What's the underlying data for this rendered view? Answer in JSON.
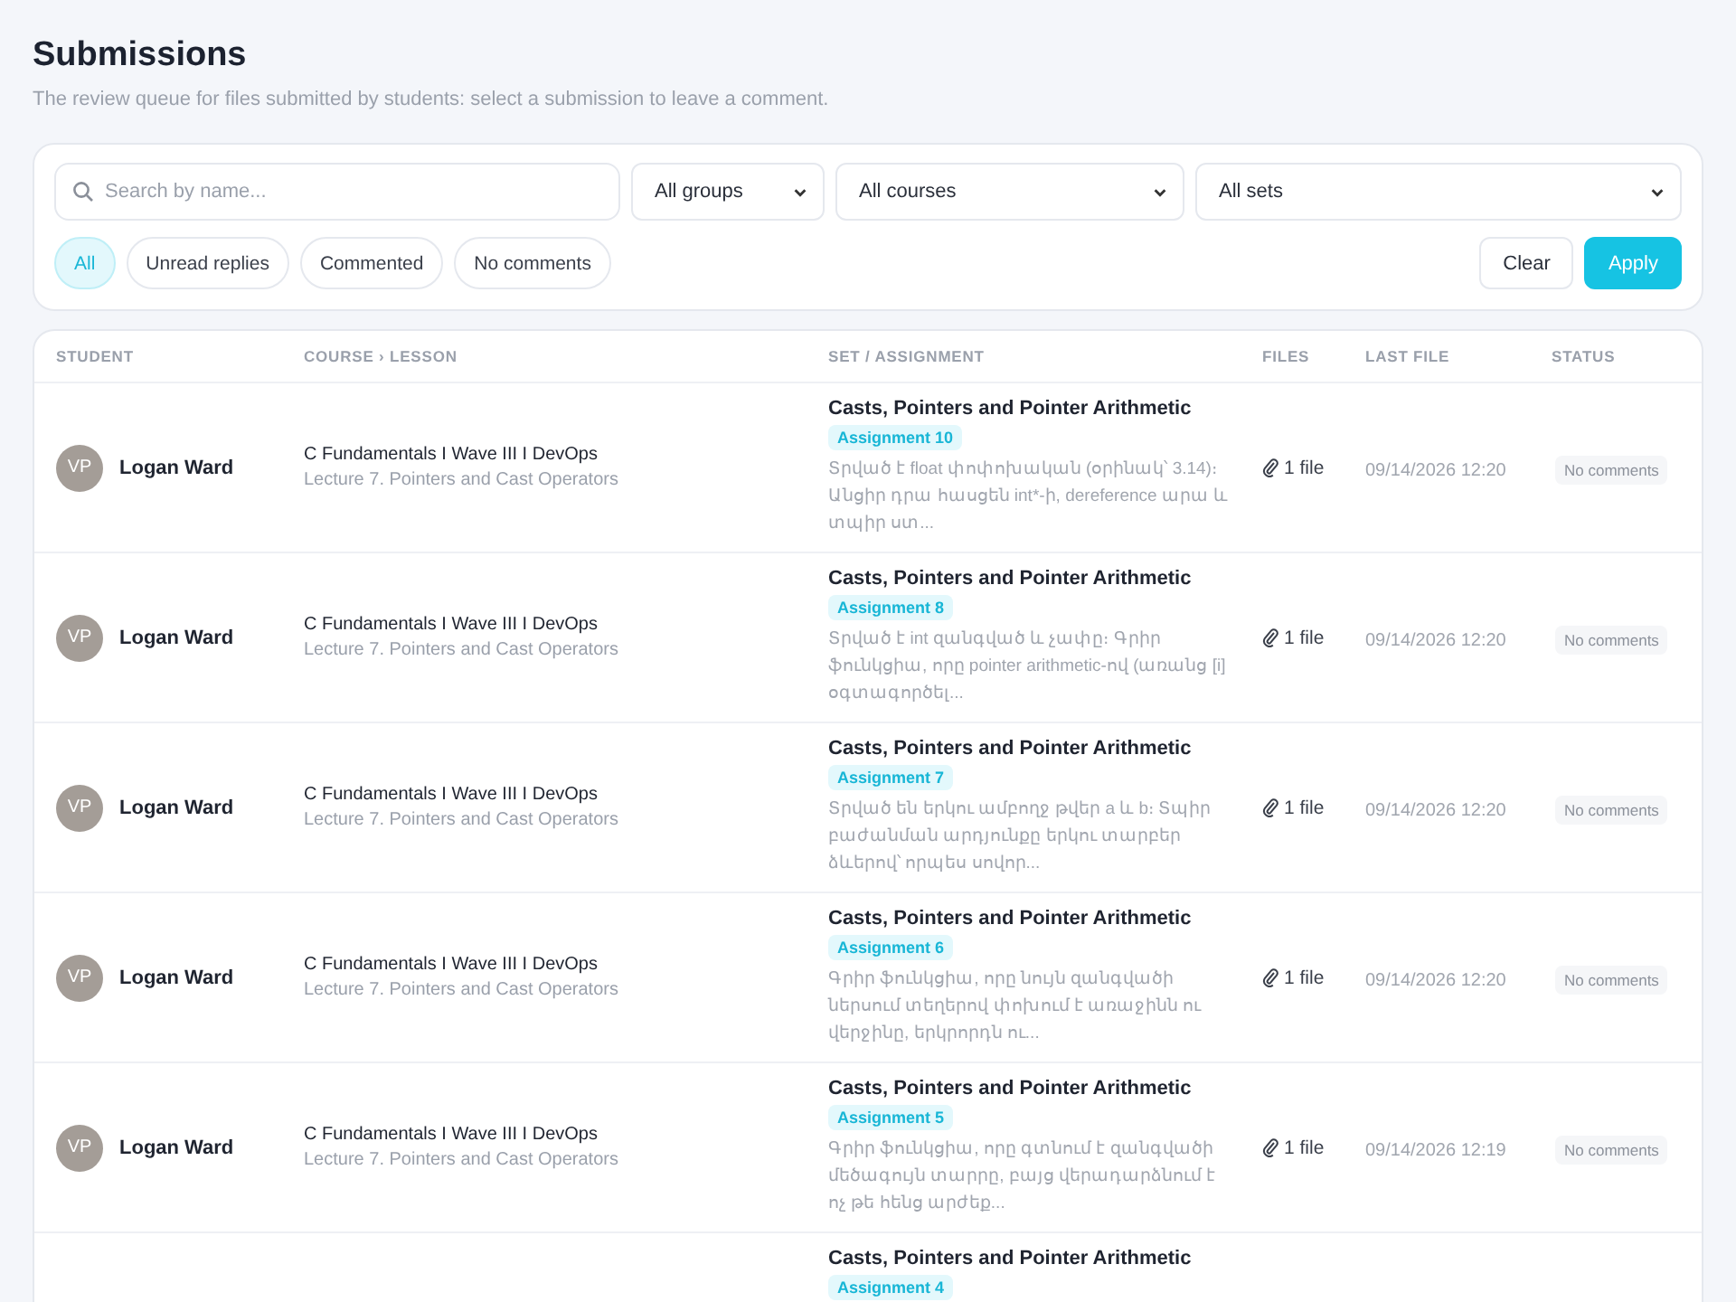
{
  "page": {
    "title": "Submissions",
    "subtitle": "The review queue for files submitted by students: select a submission to leave a comment."
  },
  "filters": {
    "search": {
      "placeholder": "Search by name..."
    },
    "selects": [
      "All groups",
      "All courses",
      "All sets"
    ],
    "chips": [
      {
        "label": "All",
        "selected": true
      },
      {
        "label": "Unread replies",
        "selected": false
      },
      {
        "label": "Commented",
        "selected": false
      },
      {
        "label": "No comments",
        "selected": false
      }
    ],
    "buttons": [
      {
        "label": "Clear",
        "kind": "secondary"
      },
      {
        "label": "Apply",
        "kind": "primary"
      }
    ]
  },
  "table": {
    "columns": [
      "STUDENT",
      "COURSE › LESSON",
      "SET / ASSIGNMENT",
      "FILES",
      "LAST FILE",
      "STATUS"
    ],
    "rows": [
      {
        "initials": "VP",
        "student": "Logan Ward",
        "course": "C Fundamentals I Wave III I DevOps",
        "lesson": "Lecture 7. Pointers and Cast Operators",
        "set": "Casts, Pointers and Pointer Arithmetic",
        "assignment": "Assignment 10",
        "description": "Տրված է float փոփոխական (օրինակ՝ 3.14)։ Անցիր դրա հասցեն int*-ի, dereference արա և տպիր ստ...",
        "files": "1 file",
        "last_file": "09/14/2026 12:20",
        "status": "No comments"
      },
      {
        "initials": "VP",
        "student": "Logan Ward",
        "course": "C Fundamentals I Wave III I DevOps",
        "lesson": "Lecture 7. Pointers and Cast Operators",
        "set": "Casts, Pointers and Pointer Arithmetic",
        "assignment": "Assignment 8",
        "description": "Տրված է int զանգված և չափը։ Գրիր ֆունկցիա, որը pointer arithmetic-ով (առանց [i] օգտագործել...",
        "files": "1 file",
        "last_file": "09/14/2026 12:20",
        "status": "No comments"
      },
      {
        "initials": "VP",
        "student": "Logan Ward",
        "course": "C Fundamentals I Wave III I DevOps",
        "lesson": "Lecture 7. Pointers and Cast Operators",
        "set": "Casts, Pointers and Pointer Arithmetic",
        "assignment": "Assignment 7",
        "description": "Տրված են երկու ամբողջ թվեր a և b։ Տպիր բաժանման արդյունքը երկու տարբեր ձևերով՝ որպես սովոր...",
        "files": "1 file",
        "last_file": "09/14/2026 12:20",
        "status": "No comments"
      },
      {
        "initials": "VP",
        "student": "Logan Ward",
        "course": "C Fundamentals I Wave III I DevOps",
        "lesson": "Lecture 7. Pointers and Cast Operators",
        "set": "Casts, Pointers and Pointer Arithmetic",
        "assignment": "Assignment 6",
        "description": "Գրիր ֆունկցիա, որը նույն զանգվածի ներսում տեղերով փոխում է առաջինն ու վերջինը, երկրորդն ու...",
        "files": "1 file",
        "last_file": "09/14/2026 12:20",
        "status": "No comments"
      },
      {
        "initials": "VP",
        "student": "Logan Ward",
        "course": "C Fundamentals I Wave III I DevOps",
        "lesson": "Lecture 7. Pointers and Cast Operators",
        "set": "Casts, Pointers and Pointer Arithmetic",
        "assignment": "Assignment 5",
        "description": "Գրիր ֆունկցիա, որը գտնում է զանգվածի մեծագույն տարրը, բայց վերադարձնում է ոչ թե հենց արժեք...",
        "files": "1 file",
        "last_file": "09/14/2026 12:19",
        "status": "No comments"
      },
      {
        "set": "Casts, Pointers and Pointer Arithmetic",
        "assignment": "Assignment 4"
      }
    ]
  }
}
